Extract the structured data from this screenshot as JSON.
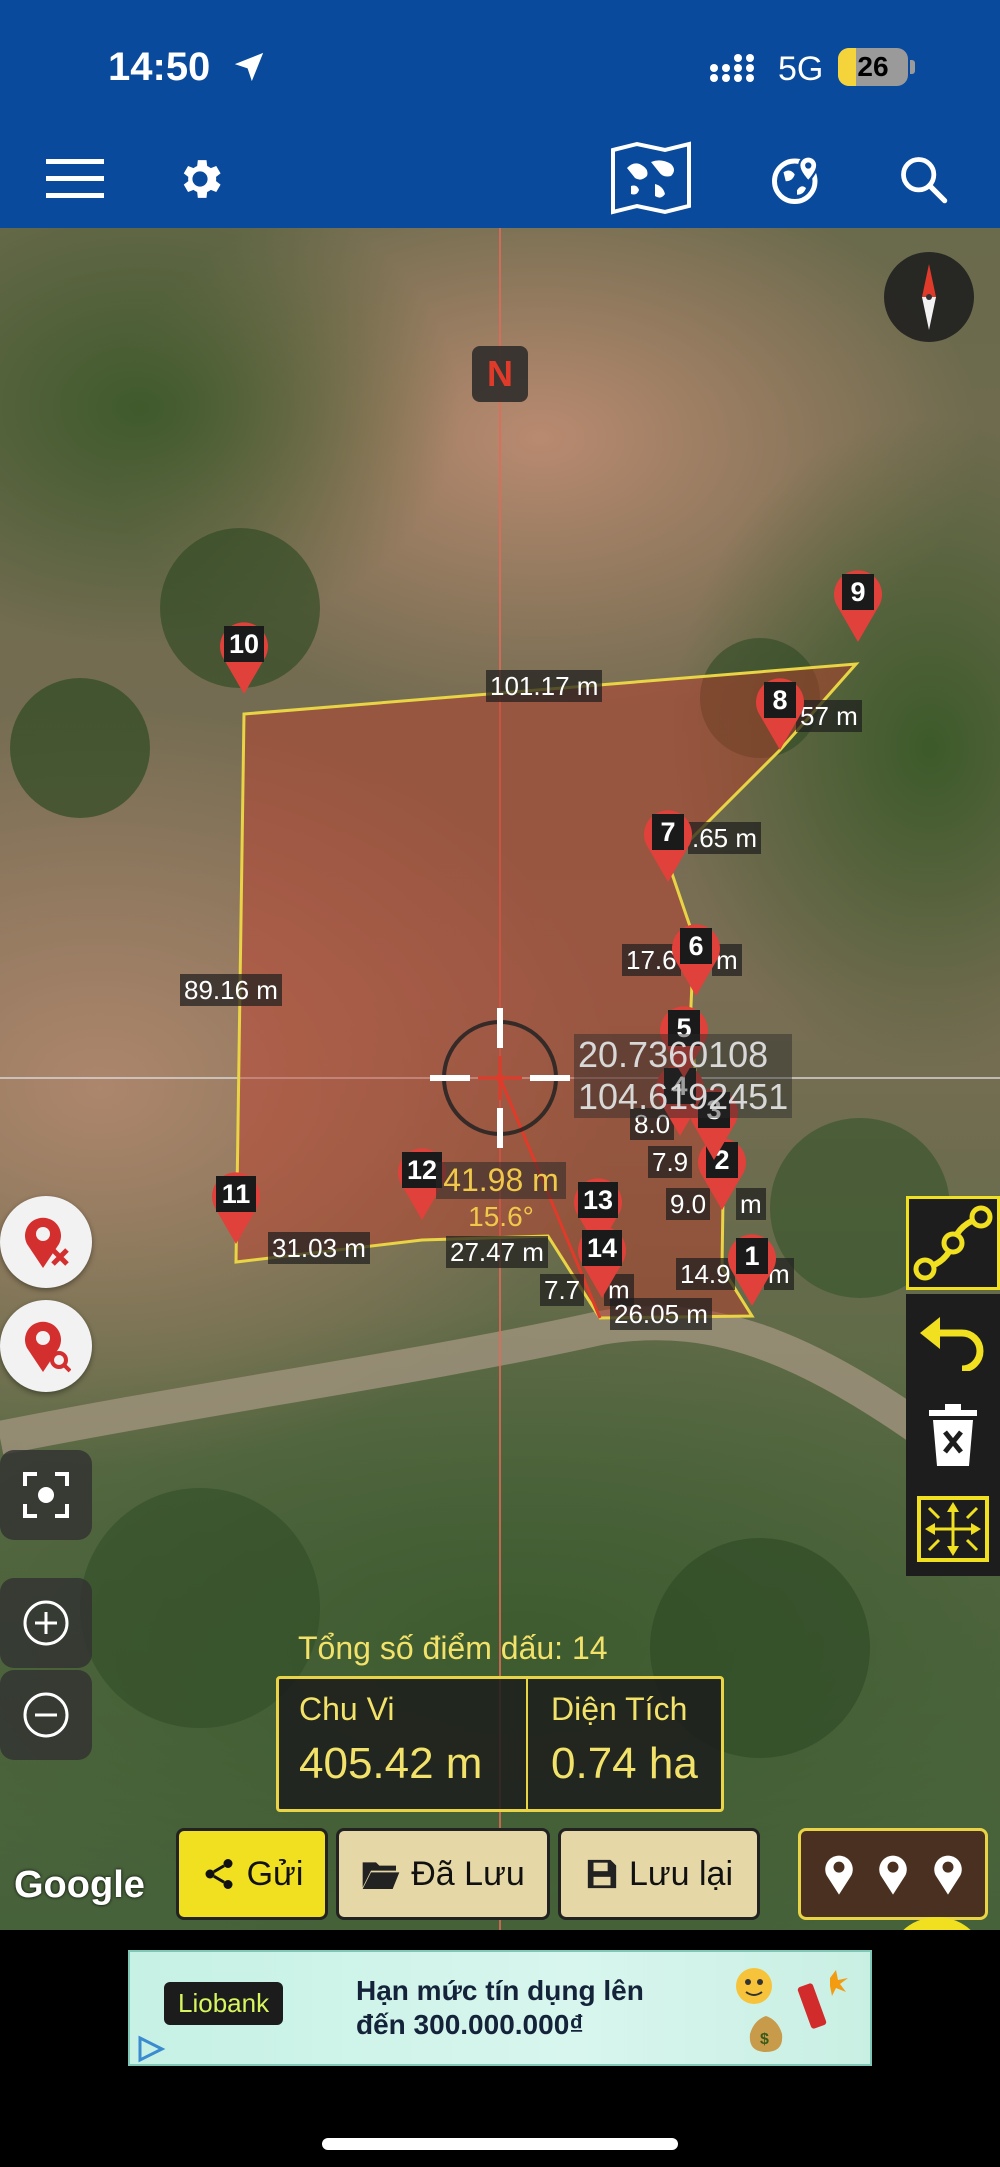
{
  "status_bar": {
    "time": "14:50",
    "network": "5G",
    "battery_level": "26",
    "battery_fraction": 0.26
  },
  "toolbar": {
    "icons": [
      "menu-icon",
      "settings-icon",
      "map-layers-icon",
      "globe-location-icon",
      "search-icon"
    ]
  },
  "map": {
    "north_label": "N",
    "distances": [
      "101.17 m",
      "57 m",
      ".65 m",
      "17.6",
      "m",
      "89.16 m",
      "8.0",
      "7.9",
      "9.0",
      "m",
      "14.9",
      "m",
      "31.03 m",
      "27.47 m",
      "7.7",
      "m",
      "26.05 m"
    ],
    "points": [
      "1",
      "2",
      "3",
      "4",
      "5",
      "6",
      "7",
      "8",
      "9",
      "10",
      "11",
      "12",
      "13",
      "14"
    ],
    "center_coords": {
      "lat": "20.7360108",
      "lon": "104.6192451"
    },
    "measure": {
      "length": "41.98 m",
      "angle": "15.6°"
    },
    "attribution": "Google"
  },
  "summary": {
    "title": "Tổng số điểm dấu: 14",
    "perimeter_label": "Chu Vi",
    "perimeter_value": "405.42 m",
    "area_label": "Diện Tích",
    "area_value": "0.74 ha"
  },
  "actions": {
    "send": "Gửi",
    "saved": "Đã Lưu",
    "save": "Lưu lại"
  },
  "colors": {
    "header": "#0a4a9c",
    "accent_yellow": "#f0e020",
    "pin_red": "#e0413a",
    "polygon_fill": "#c0392b"
  },
  "ad": {
    "brand": "Liobank",
    "line1": "Hạn mức tín dụng lên",
    "line2": "đến 300.000.000₫"
  }
}
